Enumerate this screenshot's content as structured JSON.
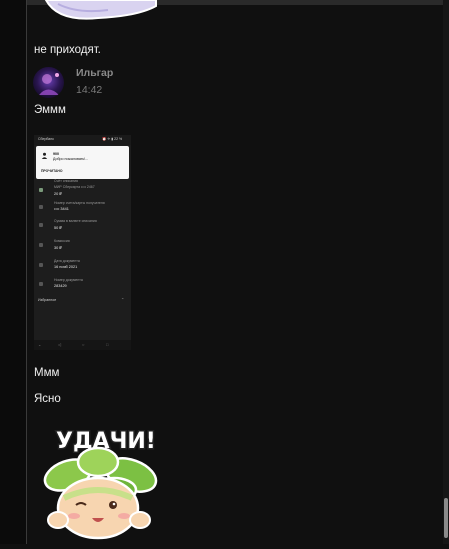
{
  "messages": {
    "m1_text": "не приходят.",
    "author": "Ильгар",
    "time": "14:42",
    "m2_text": "Эммм",
    "m3_text": "Ммм",
    "m4_text": "Ясно"
  },
  "screenshot": {
    "status_left": "Сбербанк",
    "status_right": "⏰ ✈ ▮ 22 %",
    "notif_title": "900",
    "notif_body": "Добро пожаловать!...",
    "notif_action": "ПРОЧИТАНО",
    "rows": [
      {
        "label": "Счёт списания",
        "value": ""
      },
      {
        "label": "МИР Сберкарта •••• 2467",
        "value": "20 ₽"
      },
      {
        "label": "Номер счета/карты получателя",
        "value": "•••• 3441"
      },
      {
        "label": "Сумма в валюте списания",
        "value": "50 ₽"
      },
      {
        "label": "Комиссия",
        "value": "30 ₽"
      },
      {
        "label": "Дата документа",
        "value": "16 нояб 2021"
      },
      {
        "label": "Номер документа",
        "value": "283429"
      }
    ],
    "favorites": "Избранное"
  },
  "sticker": {
    "caption": "УДАЧИ!"
  },
  "colors": {
    "background": "#101010",
    "author": "#8a8a8a",
    "text": "#f0f0f0",
    "sticker_leaf": "#7cc043",
    "sticker_skin": "#f7d5b0"
  }
}
